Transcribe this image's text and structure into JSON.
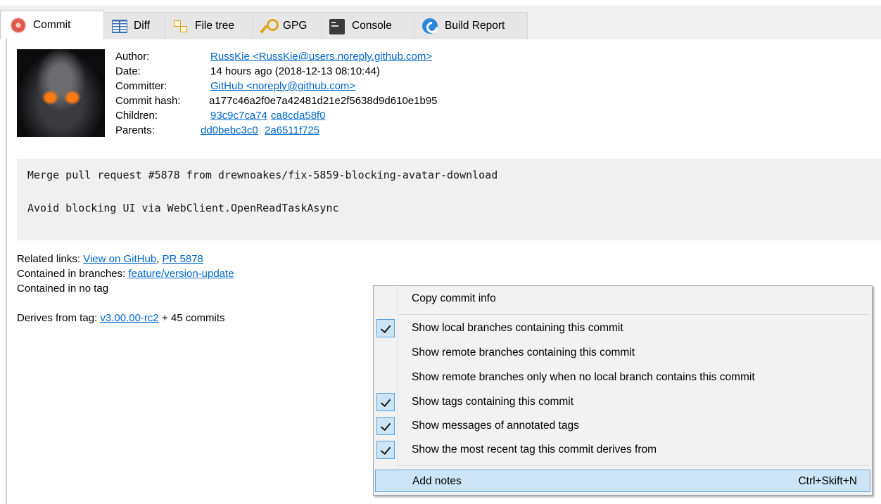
{
  "tabs": [
    {
      "label": "Commit",
      "icon": "commit-icon"
    },
    {
      "label": "Diff",
      "icon": "diff-icon"
    },
    {
      "label": "File tree",
      "icon": "file-tree-icon"
    },
    {
      "label": "GPG",
      "icon": "key-icon"
    },
    {
      "label": "Console",
      "icon": "console-icon"
    },
    {
      "label": "Build Report",
      "icon": "build-report-icon"
    }
  ],
  "commit": {
    "author_label": "Author:",
    "author": "RussKie <RussKie@users.noreply.github.com>",
    "date_label": "Date:",
    "date": "14 hours ago (2018-12-13 08:10:44)",
    "committer_label": "Committer:",
    "committer": "GitHub <noreply@github.com>",
    "hash_label": "Commit hash:",
    "hash": "a177c46a2f0e7a42481d21e2f5638d9d610e1b95",
    "children_label": "Children:",
    "children": [
      "93c9c7ca74",
      "ca8cda58f0"
    ],
    "parents_label": "Parents:",
    "parents": [
      "dd0bebc3c0",
      "2a6511f725"
    ]
  },
  "message": {
    "line1": "Merge pull request #5878 from drewnoakes/fix-5859-blocking-avatar-download",
    "line2": "Avoid blocking UI via WebClient.OpenReadTaskAsync"
  },
  "details": {
    "related_label": "Related links: ",
    "related_links": [
      "View on GitHub",
      "PR 5878"
    ],
    "branches_label": "Contained in branches: ",
    "branch": "feature/version-update",
    "tags_text": "Contained in no tag",
    "derives_label": "Derives from tag: ",
    "derives_tag": "v3.00.00-rc2",
    "derives_suffix": " + 45 commits"
  },
  "context_menu": {
    "items": [
      {
        "label": "Copy commit info",
        "checked": false
      },
      {
        "label": "Show local branches containing this commit",
        "checked": true
      },
      {
        "label": "Show remote branches containing this commit",
        "checked": false
      },
      {
        "label": "Show remote branches only when no local branch contains this commit",
        "checked": false
      },
      {
        "label": "Show tags containing this commit",
        "checked": true
      },
      {
        "label": "Show messages of annotated tags",
        "checked": true
      },
      {
        "label": "Show the most recent tag this commit derives from",
        "checked": true
      },
      {
        "label": "Add notes",
        "shortcut": "Ctrl+Skift+N",
        "checked": false,
        "highlighted": true
      }
    ]
  }
}
